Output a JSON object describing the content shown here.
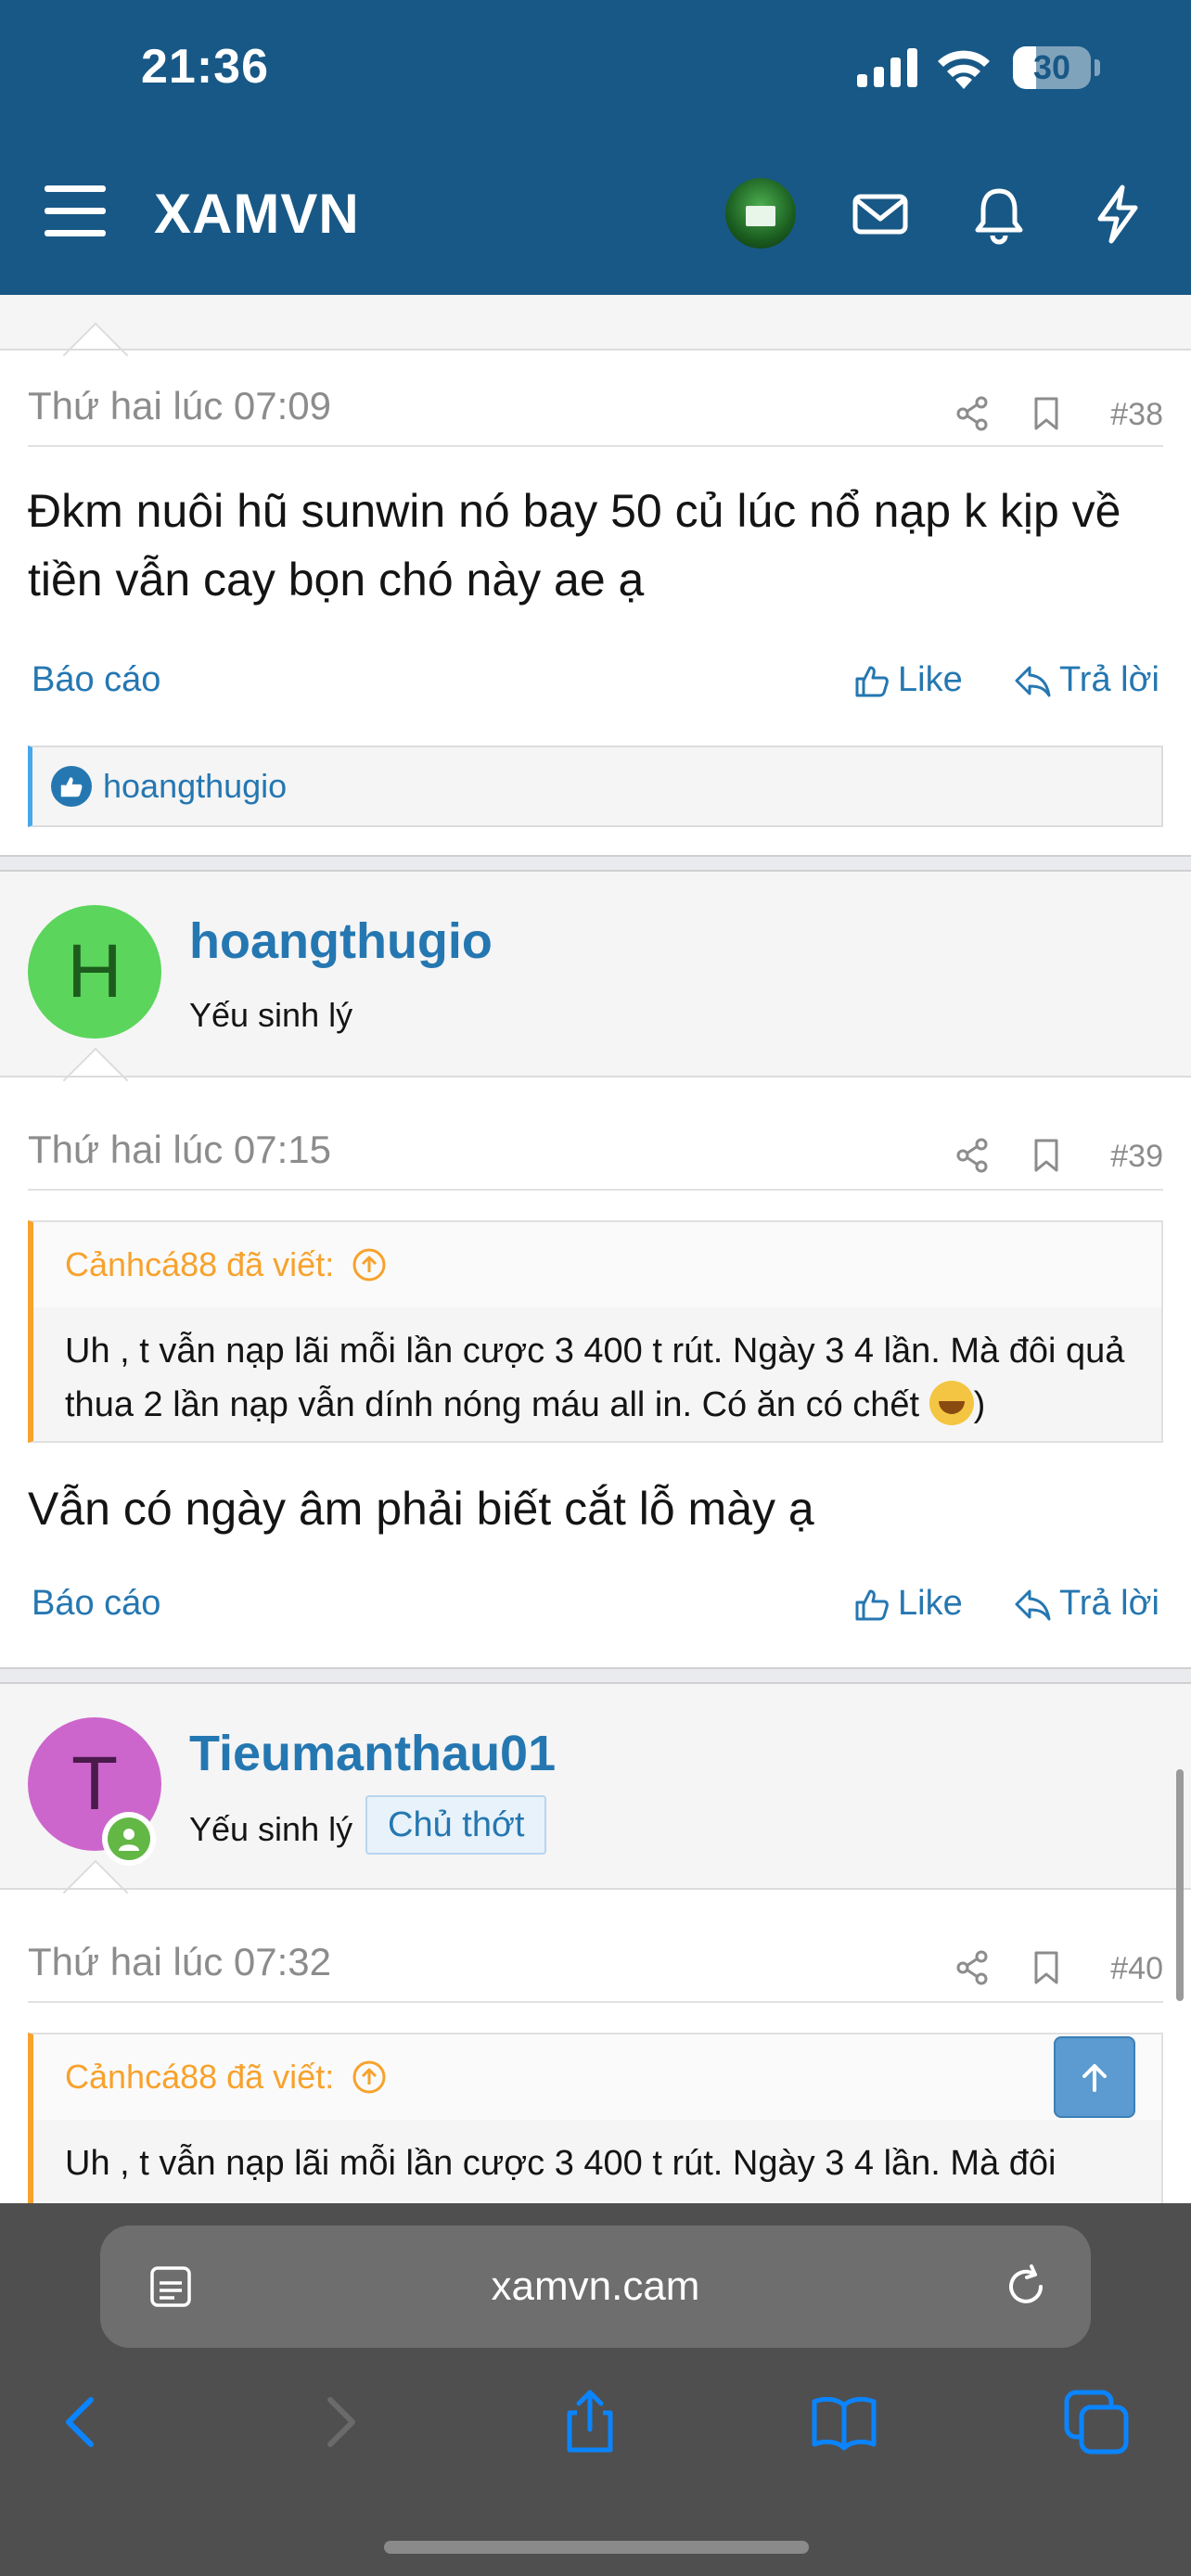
{
  "status_bar": {
    "time": "21:36",
    "battery": 30
  },
  "header": {
    "site_title": "XAMVN",
    "icons": [
      "menu-icon",
      "avatar",
      "mail-icon",
      "bell-icon",
      "lightning-icon"
    ]
  },
  "posts": [
    {
      "date": "Thứ hai lúc 07:09",
      "number": "#38",
      "text": "Đkm nuôi hũ sunwin nó bay 50 củ lúc nổ nạp k kịp về tiền vẫn cay bọn chó này ae ạ",
      "report": "Báo cáo",
      "like": "Like",
      "reply": "Trả lời",
      "reactions": "hoangthugio"
    },
    {
      "author": "hoangthugio",
      "avatar_letter": "H",
      "avatar_color": "#5bd55b",
      "user_title": "Yếu sinh lý",
      "date": "Thứ hai lúc 07:15",
      "number": "#39",
      "quote_author": "Cảnhcá88 đã viết:",
      "quote_text": "Uh , t vẫn nạp lãi mỗi lần cược 3 400 t rút. Ngày 3 4 lần. Mà đôi quả thua 2 lần nạp vẫn dính nóng máu all in. Có ăn có chết",
      "quote_tail": ")",
      "text": "Vẫn có ngày âm phải biết cắt lỗ mày ạ",
      "report": "Báo cáo",
      "like": "Like",
      "reply": "Trả lời"
    },
    {
      "author": "Tieumanthau01",
      "avatar_letter": "T",
      "avatar_color": "#cc66cc",
      "user_title": "Yếu sinh lý",
      "badge": "Chủ thớt",
      "date": "Thứ hai lúc 07:32",
      "number": "#40",
      "quote_author": "Cảnhcá88 đã viết:",
      "quote_text": "Uh , t vẫn nạp lãi mỗi lần cược 3 400 t rút. Ngày 3 4 lần. Mà đôi"
    }
  ],
  "browser": {
    "url": "xamvn.cam"
  },
  "colors": {
    "header_bg": "#185886",
    "link": "#2577b1",
    "quote_accent": "#f7a22d"
  }
}
